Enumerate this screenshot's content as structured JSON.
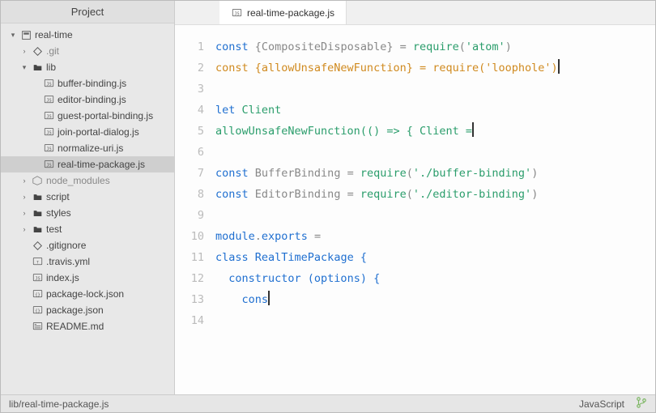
{
  "sidebar": {
    "title": "Project",
    "root": "real-time",
    "items": [
      {
        "label": ".git",
        "icon": "diamond"
      },
      {
        "label": "lib",
        "icon": "folder"
      },
      {
        "label": "buffer-binding.js",
        "icon": "js"
      },
      {
        "label": "editor-binding.js",
        "icon": "js"
      },
      {
        "label": "guest-portal-binding.js",
        "icon": "js"
      },
      {
        "label": "join-portal-dialog.js",
        "icon": "js"
      },
      {
        "label": "normalize-uri.js",
        "icon": "js"
      },
      {
        "label": "real-time-package.js",
        "icon": "js"
      },
      {
        "label": "node_modules",
        "icon": "pkg"
      },
      {
        "label": "script",
        "icon": "folder"
      },
      {
        "label": "styles",
        "icon": "folder"
      },
      {
        "label": "test",
        "icon": "folder"
      },
      {
        "label": ".gitignore",
        "icon": "diamond"
      },
      {
        "label": ".travis.yml",
        "icon": "yml"
      },
      {
        "label": "index.js",
        "icon": "js"
      },
      {
        "label": "package-lock.json",
        "icon": "json"
      },
      {
        "label": "package.json",
        "icon": "json"
      },
      {
        "label": "README.md",
        "icon": "md"
      }
    ]
  },
  "tabs": {
    "active": {
      "label": "real-time-package.js",
      "icon": "js"
    }
  },
  "code": {
    "lines": [
      {
        "n": 1,
        "segs": [
          {
            "t": "const ",
            "c": "kw"
          },
          {
            "t": "{CompositeDisposable} ",
            "c": "plain"
          },
          {
            "t": "= ",
            "c": "op"
          },
          {
            "t": "require",
            "c": "fn"
          },
          {
            "t": "(",
            "c": "plain"
          },
          {
            "t": "'atom'",
            "c": "str"
          },
          {
            "t": ")",
            "c": "plain"
          }
        ]
      },
      {
        "n": 2,
        "segs": [
          {
            "t": "const {allowUnsafeNewFunction} = require('loophole')",
            "c": "new-line"
          }
        ],
        "cursor": true
      },
      {
        "n": 3,
        "segs": []
      },
      {
        "n": 4,
        "segs": [
          {
            "t": "let ",
            "c": "kw"
          },
          {
            "t": "Client",
            "c": "fn"
          }
        ]
      },
      {
        "n": 5,
        "segs": [
          {
            "t": "allowUnsafeNewFunction",
            "c": "fn"
          },
          {
            "t": "(() => { ",
            "c": "fn"
          },
          {
            "t": "Client ",
            "c": "fn"
          },
          {
            "t": "=",
            "c": "fn"
          }
        ],
        "cursor": true
      },
      {
        "n": 6,
        "segs": []
      },
      {
        "n": 7,
        "segs": [
          {
            "t": "const ",
            "c": "kw"
          },
          {
            "t": "BufferBinding ",
            "c": "plain"
          },
          {
            "t": "= ",
            "c": "op"
          },
          {
            "t": "require",
            "c": "fn"
          },
          {
            "t": "(",
            "c": "plain"
          },
          {
            "t": "'./buffer-binding'",
            "c": "str"
          },
          {
            "t": ")",
            "c": "plain"
          }
        ]
      },
      {
        "n": 8,
        "segs": [
          {
            "t": "const ",
            "c": "kw"
          },
          {
            "t": "EditorBinding ",
            "c": "plain"
          },
          {
            "t": "= ",
            "c": "op"
          },
          {
            "t": "require",
            "c": "fn"
          },
          {
            "t": "(",
            "c": "plain"
          },
          {
            "t": "'./editor-binding'",
            "c": "str"
          },
          {
            "t": ")",
            "c": "plain"
          }
        ]
      },
      {
        "n": 9,
        "segs": []
      },
      {
        "n": 10,
        "segs": [
          {
            "t": "module",
            "c": "type"
          },
          {
            "t": ".",
            "c": "plain"
          },
          {
            "t": "exports ",
            "c": "type"
          },
          {
            "t": "=",
            "c": "op"
          }
        ]
      },
      {
        "n": 11,
        "segs": [
          {
            "t": "class ",
            "c": "type"
          },
          {
            "t": "RealTimePackage ",
            "c": "type"
          },
          {
            "t": "{",
            "c": "type"
          }
        ]
      },
      {
        "n": 12,
        "segs": [
          {
            "t": "  constructor ",
            "c": "type"
          },
          {
            "t": "(options) {",
            "c": "type"
          }
        ]
      },
      {
        "n": 13,
        "segs": [
          {
            "t": "    cons",
            "c": "type"
          }
        ],
        "cursor": true
      },
      {
        "n": 14,
        "segs": []
      }
    ]
  },
  "status": {
    "path": "lib/real-time-package.js",
    "lang": "JavaScript"
  }
}
